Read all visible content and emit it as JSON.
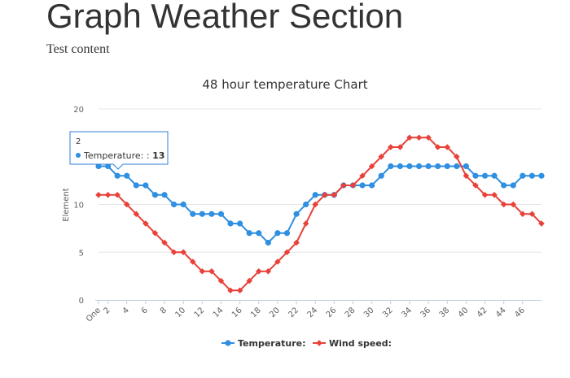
{
  "page": {
    "heading": "Graph Weather Section",
    "subtext": "Test content"
  },
  "colors": {
    "temperature": "#2f8fe0",
    "wind": "#e8423a",
    "grid": "#e6e6e6",
    "axis": "#c0d0e0"
  },
  "chart_data": {
    "type": "line",
    "title": "48 hour temperature Chart",
    "xlabel": "",
    "ylabel": "Element",
    "ylim": [
      0,
      20
    ],
    "yticks": [
      0,
      5,
      10,
      20
    ],
    "grid": true,
    "legend_position": "bottom-center",
    "x": [
      "One",
      "2",
      "3",
      "4",
      "5",
      "6",
      "7",
      "8",
      "9",
      "10",
      "11",
      "12",
      "13",
      "14",
      "15",
      "16",
      "17",
      "18",
      "19",
      "20",
      "21",
      "22",
      "23",
      "24",
      "25",
      "26",
      "27",
      "28",
      "29",
      "30",
      "31",
      "32",
      "33",
      "34",
      "35",
      "36",
      "37",
      "38",
      "39",
      "40",
      "41",
      "42",
      "43",
      "44",
      "45",
      "46",
      "47"
    ],
    "xtick_labels": [
      "One",
      "2",
      "4",
      "6",
      "8",
      "10",
      "12",
      "14",
      "16",
      "18",
      "20",
      "22",
      "24",
      "26",
      "28",
      "30",
      "32",
      "34",
      "36",
      "38",
      "40",
      "42",
      "44",
      "46"
    ],
    "series": [
      {
        "name": "Temperature:",
        "marker": "circle",
        "values": [
          14,
          14,
          13,
          13,
          12,
          12,
          11,
          11,
          10,
          10,
          9,
          9,
          9,
          9,
          8,
          8,
          7,
          7,
          6,
          7,
          7,
          9,
          10,
          11,
          11,
          11,
          12,
          12,
          12,
          12,
          13,
          14,
          14,
          14,
          14,
          14,
          14,
          14,
          14,
          14,
          13,
          13,
          13,
          12,
          12,
          13,
          13,
          13
        ]
      },
      {
        "name": "Wind speed:",
        "marker": "diamond",
        "values": [
          11,
          11,
          11,
          10,
          9,
          8,
          7,
          6,
          5,
          5,
          4,
          3,
          3,
          2,
          1,
          1,
          2,
          3,
          3,
          4,
          5,
          6,
          8,
          10,
          11,
          11,
          12,
          12,
          13,
          14,
          15,
          16,
          16,
          17,
          17,
          17,
          16,
          16,
          15,
          13,
          12,
          11,
          11,
          10,
          10,
          9,
          9,
          8
        ]
      }
    ],
    "tooltip": {
      "header": "2",
      "label": "Temperature: : ",
      "value": "13"
    }
  }
}
